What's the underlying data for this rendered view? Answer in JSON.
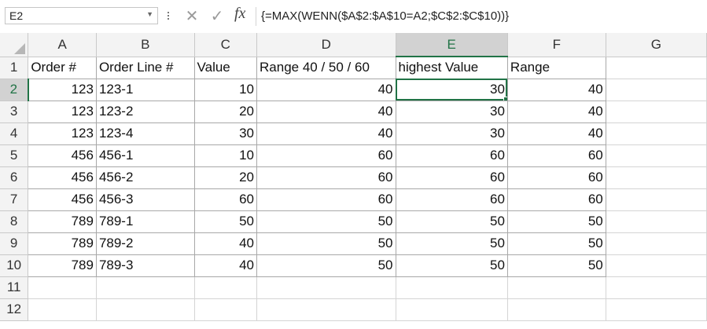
{
  "formula_bar": {
    "name_box": "E2",
    "formula": "{=MAX(WENN($A$2:$A$10=A2;$C$2:$C$10))}",
    "fx_label": "fx",
    "cancel_icon": "close-icon",
    "enter_icon": "check-icon"
  },
  "columns": [
    "A",
    "B",
    "C",
    "D",
    "E",
    "F",
    "G"
  ],
  "selected_column": "E",
  "selected_row": "2",
  "rows": [
    {
      "n": "1",
      "cells": [
        "Order #",
        "Order Line #",
        "Value",
        "Range 40 / 50 / 60",
        "highest Value",
        "Range",
        ""
      ]
    },
    {
      "n": "2",
      "cells": [
        "123",
        "123-1",
        "10",
        "40",
        "30",
        "40",
        ""
      ]
    },
    {
      "n": "3",
      "cells": [
        "123",
        "123-2",
        "20",
        "40",
        "30",
        "40",
        ""
      ]
    },
    {
      "n": "4",
      "cells": [
        "123",
        "123-4",
        "30",
        "40",
        "30",
        "40",
        ""
      ]
    },
    {
      "n": "5",
      "cells": [
        "456",
        "456-1",
        "10",
        "60",
        "60",
        "60",
        ""
      ]
    },
    {
      "n": "6",
      "cells": [
        "456",
        "456-2",
        "20",
        "60",
        "60",
        "60",
        ""
      ]
    },
    {
      "n": "7",
      "cells": [
        "456",
        "456-3",
        "60",
        "60",
        "60",
        "60",
        ""
      ]
    },
    {
      "n": "8",
      "cells": [
        "789",
        "789-1",
        "50",
        "50",
        "50",
        "50",
        ""
      ]
    },
    {
      "n": "9",
      "cells": [
        "789",
        "789-2",
        "40",
        "50",
        "50",
        "50",
        ""
      ]
    },
    {
      "n": "10",
      "cells": [
        "789",
        "789-3",
        "40",
        "50",
        "50",
        "50",
        ""
      ]
    },
    {
      "n": "11",
      "cells": [
        "",
        "",
        "",
        "",
        "",
        "",
        ""
      ]
    },
    {
      "n": "12",
      "cells": [
        "",
        "",
        "",
        "",
        "",
        "",
        ""
      ]
    }
  ],
  "accent_color": "#217346"
}
